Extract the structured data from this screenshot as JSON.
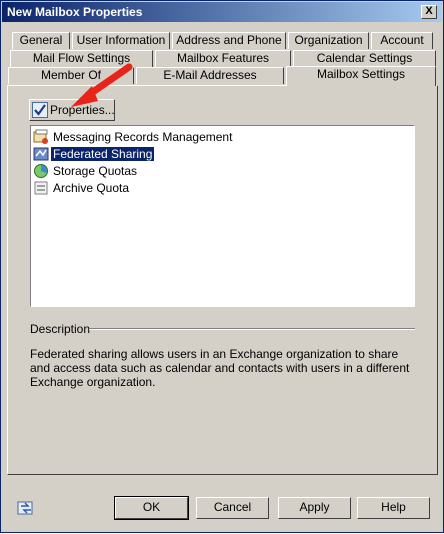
{
  "window": {
    "title": "New Mailbox Properties",
    "close_label": "X"
  },
  "tabs": {
    "row1": [
      "General",
      "User Information",
      "Address and Phone",
      "Organization",
      "Account"
    ],
    "row2": [
      "Mail Flow Settings",
      "Mailbox Features",
      "Calendar Settings"
    ],
    "row3": [
      "Member Of",
      "E-Mail Addresses",
      "Mailbox Settings"
    ],
    "active": "Mailbox Settings"
  },
  "toolbar": {
    "properties_label": "Properties..."
  },
  "settings_list": {
    "items": [
      {
        "label": "Messaging Records Management",
        "icon": "records-management-icon",
        "selected": false
      },
      {
        "label": "Federated Sharing",
        "icon": "federated-sharing-icon",
        "selected": true
      },
      {
        "label": "Storage Quotas",
        "icon": "storage-quotas-icon",
        "selected": false
      },
      {
        "label": "Archive Quota",
        "icon": "archive-quota-icon",
        "selected": false
      }
    ]
  },
  "description": {
    "label": "Description",
    "text": "Federated sharing allows users in an Exchange organization to share and access data such as calendar and contacts with users in a different Exchange organization."
  },
  "buttons": {
    "ok": "OK",
    "cancel": "Cancel",
    "apply": "Apply",
    "help": "Help"
  },
  "colors": {
    "dialog_background": "#d4d0c8",
    "title_bar": "#0a246a",
    "selection": "#0a246a",
    "annotation_arrow": "#e8231a"
  }
}
